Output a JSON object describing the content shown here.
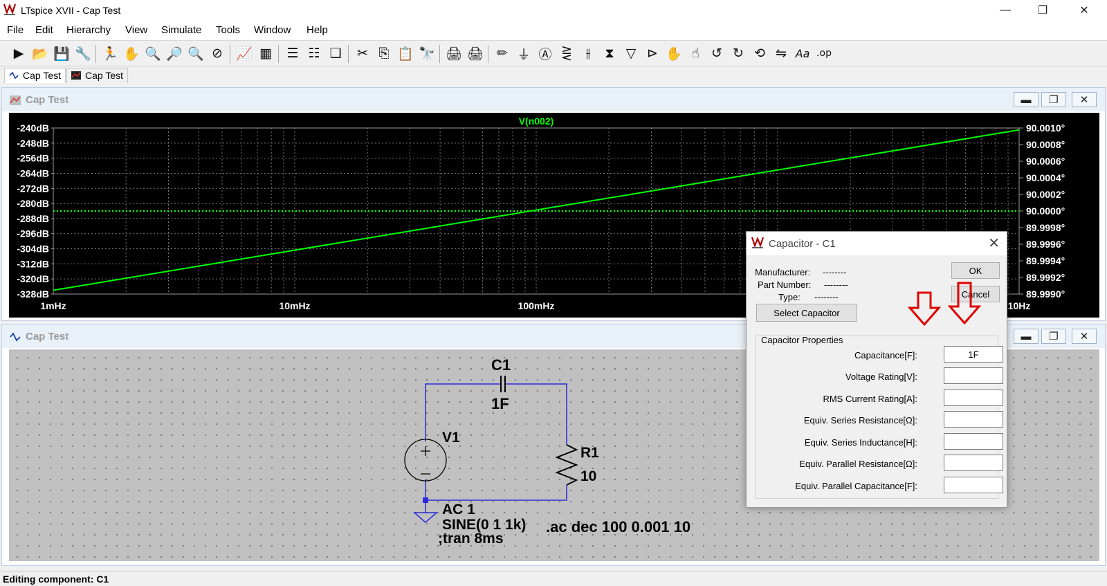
{
  "app": {
    "title": "LTspice XVII - Cap Test"
  },
  "window_controls": {
    "minimize": "—",
    "restore": "❐",
    "close": "✕"
  },
  "menu": [
    "File",
    "Edit",
    "Hierarchy",
    "View",
    "Simulate",
    "Tools",
    "Window",
    "Help"
  ],
  "toolbar": {
    "icons": [
      "run-icon",
      "open-icon",
      "save-icon",
      "control-panel-icon",
      "halt-icon",
      "pan-icon",
      "zoom-in-icon",
      "zoom-fit-icon",
      "zoom-out-icon",
      "zoom-cancel-icon",
      "autorange-icon",
      "grid-icon",
      "tile-horizontal-icon",
      "tile-vertical-icon",
      "cascade-icon",
      "cut-icon",
      "copy-icon",
      "paste-icon",
      "find-icon",
      "print-setup-icon",
      "print-icon",
      "wire-icon",
      "ground-icon",
      "label-net-icon",
      "resistor-icon",
      "capacitor-icon",
      "inductor-icon",
      "diode-icon",
      "component-icon",
      "move-icon",
      "drag-icon",
      "undo-icon",
      "redo-icon",
      "rotate-icon",
      "mirror-icon",
      "text-icon",
      "spice-directive-icon"
    ],
    "glyphs": [
      "▶",
      "📂",
      "💾",
      "🔧",
      "🏃",
      "✋",
      "🔍",
      "🔎",
      "🔍",
      "⊘",
      "📈",
      "▦",
      "☰",
      "☷",
      "❏",
      "✂",
      "⎘",
      "📋",
      "🔭",
      "🖨",
      "🖨",
      "✏",
      "⏚",
      "Ⓐ",
      "⋛",
      "⫲",
      "⧗",
      "▽",
      "⊳",
      "✋",
      "☝",
      "↺",
      "↻",
      "⟲",
      "⇋",
      "Aa",
      ".op"
    ]
  },
  "tabs": [
    {
      "label": "Cap Test",
      "active": true
    },
    {
      "label": "Cap Test",
      "active": false
    }
  ],
  "plot_window": {
    "title": "Cap Test",
    "trace_name": "V(n002)",
    "trace_color": "#00ff00",
    "background": "#000000",
    "left_axis_labels": [
      "-240dB",
      "-248dB",
      "-256dB",
      "-264dB",
      "-272dB",
      "-280dB",
      "-288dB",
      "-296dB",
      "-304dB",
      "-312dB",
      "-320dB",
      "-328dB"
    ],
    "right_axis_labels": [
      "90.0010°",
      "90.0008°",
      "90.0006°",
      "90.0004°",
      "90.0002°",
      "90.0000°",
      "89.9998°",
      "89.9996°",
      "89.9994°",
      "89.9992°",
      "89.9990°"
    ],
    "x_axis_labels": [
      "1mHz",
      "10mHz",
      "100mHz",
      "10Hz"
    ]
  },
  "chart_data": {
    "type": "line",
    "title": "V(n002)",
    "x_scale": "log",
    "xlim": [
      0.001,
      10
    ],
    "ylim": [
      -328,
      -240
    ],
    "y2lim": [
      89.999,
      90.001
    ],
    "grid": true,
    "series": [
      {
        "name": "V(n002)",
        "axis": "magnitude-dB",
        "style": "solid",
        "color": "#00ff00",
        "x": [
          0.001,
          10
        ],
        "y": [
          -326,
          -241
        ]
      },
      {
        "name": "V(n002)",
        "axis": "phase-deg",
        "style": "dotted",
        "color": "#00ff00",
        "x": [
          0.001,
          10
        ],
        "y": [
          90.0,
          90.0
        ]
      }
    ]
  },
  "schematic_window": {
    "title": "Cap Test",
    "components": {
      "cap_name": "C1",
      "cap_value": "1F",
      "src_name": "V1",
      "res_name": "R1",
      "res_value": "10"
    },
    "texts": {
      "src_ac": "AC 1",
      "src_sine": "SINE(0 1 1k)",
      "tran": ";tran 8ms",
      "ac_directive": ".ac dec 100 0.001 10"
    }
  },
  "dialog": {
    "title": "Capacitor - C1",
    "close": "✕",
    "manufacturer_label": "Manufacturer:",
    "manufacturer_value": "--------",
    "part_label": "Part Number:",
    "part_value": "--------",
    "type_label": "Type:",
    "type_value": "--------",
    "ok": "OK",
    "cancel": "Cancel",
    "select": "Select Capacitor",
    "group_label": "Capacitor Properties",
    "props": [
      {
        "label": "Capacitance[F]:",
        "value": "1F"
      },
      {
        "label": "Voltage Rating[V]:",
        "value": ""
      },
      {
        "label": "RMS Current Rating[A]:",
        "value": ""
      },
      {
        "label": "Equiv. Series Resistance[Ω]:",
        "value": ""
      },
      {
        "label": "Equiv. Series Inductance[H]:",
        "value": ""
      },
      {
        "label": "Equiv. Parallel Resistance[Ω]:",
        "value": ""
      },
      {
        "label": "Equiv. Parallel Capacitance[F]:",
        "value": ""
      }
    ]
  },
  "annotation_arrow_color": "#e00000",
  "status": "Editing component: C1"
}
